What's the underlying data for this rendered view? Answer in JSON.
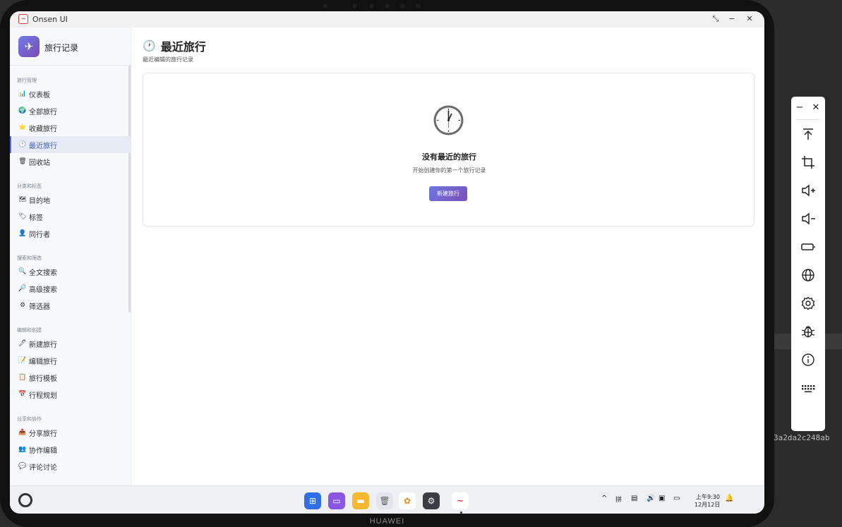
{
  "window": {
    "title": "Onsen UI"
  },
  "window_controls": {
    "restore": "⤡",
    "minimize": "−",
    "close": "✕"
  },
  "sidebar": {
    "app_title": "旅行记录",
    "sections": [
      {
        "label": "旅行管理",
        "items": [
          {
            "icon": "📊",
            "label": "仪表板",
            "active": false
          },
          {
            "icon": "🌍",
            "label": "全部旅行",
            "active": false
          },
          {
            "icon": "⭐",
            "label": "收藏旅行",
            "active": false
          },
          {
            "icon": "🕐",
            "label": "最近旅行",
            "active": true
          },
          {
            "icon": "🗑",
            "label": "回收站",
            "active": false
          }
        ]
      },
      {
        "label": "分类和标签",
        "items": [
          {
            "icon": "🗺",
            "label": "目的地",
            "active": false
          },
          {
            "icon": "🏷",
            "label": "标签",
            "active": false
          },
          {
            "icon": "👤",
            "label": "同行者",
            "active": false
          }
        ]
      },
      {
        "label": "搜索和筛选",
        "items": [
          {
            "icon": "🔍",
            "label": "全文搜索",
            "active": false
          },
          {
            "icon": "🔎",
            "label": "高级搜索",
            "active": false
          },
          {
            "icon": "⚙",
            "label": "筛选器",
            "active": false
          }
        ]
      },
      {
        "label": "编辑和创建",
        "items": [
          {
            "icon": "🖊",
            "label": "新建旅行",
            "active": false
          },
          {
            "icon": "📝",
            "label": "编辑旅行",
            "active": false
          },
          {
            "icon": "📋",
            "label": "旅行模板",
            "active": false
          },
          {
            "icon": "📅",
            "label": "行程规划",
            "active": false
          }
        ]
      },
      {
        "label": "分享和协作",
        "items": [
          {
            "icon": "📤",
            "label": "分享旅行",
            "active": false
          },
          {
            "icon": "👥",
            "label": "协作编辑",
            "active": false
          },
          {
            "icon": "💬",
            "label": "评论讨论",
            "active": false
          }
        ]
      }
    ]
  },
  "main": {
    "title_icon": "🕐",
    "title": "最近旅行",
    "subtitle": "最近编辑的旅行记录",
    "empty_state": {
      "title": "没有最近的旅行",
      "description": "开始创建你的第一个旅行记录",
      "button_label": "新建旅行"
    }
  },
  "taskbar": {
    "tray_input": "拼",
    "time": "上午9:30",
    "date": "12月12日"
  },
  "floating_toolbar": {
    "minimize": "−",
    "close": "✕"
  },
  "overlay_hash": "3a2da2c248ab",
  "device_brand": "HUAWEI",
  "colors": {
    "accent": "#5a6ed6",
    "button_start": "#6d78e0",
    "button_end": "#7a4fba"
  }
}
